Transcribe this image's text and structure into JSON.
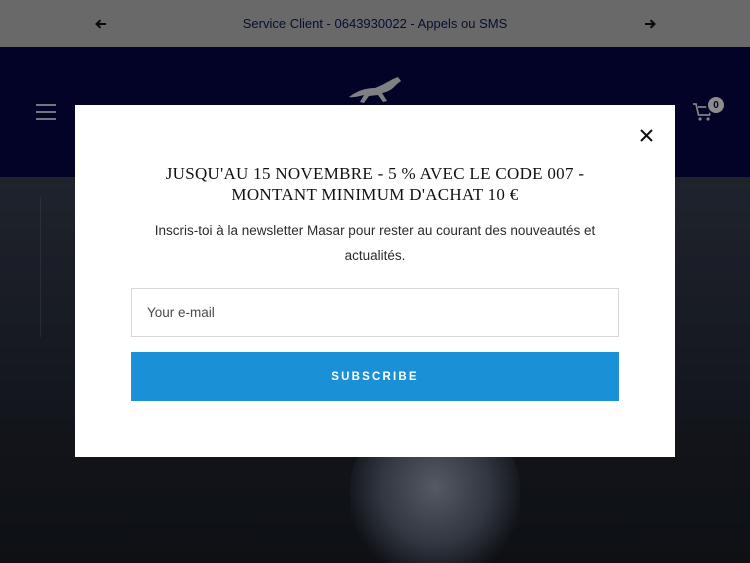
{
  "announcement": {
    "text": "Service Client - 0643930022 - Appels ou SMS",
    "prev_icon": "arrow-left-icon",
    "next_icon": "arrow-right-icon"
  },
  "header": {
    "menu_icon": "hamburger-menu-icon",
    "logo_icon": "horse-logo-icon",
    "cart_icon": "cart-icon",
    "cart_count": "0"
  },
  "popup": {
    "title_line1": "JUSQU'AU 15 NOVEMBRE - 5 % AVEC LE CODE 007 -",
    "title_line2": "MONTANT MINIMUM D'ACHAT 10 €",
    "body_line1": "Inscris-toi à la newsletter Masar pour rester au courant des nouveautés et",
    "body_line2": "actualités.",
    "email_placeholder": "Your e-mail",
    "subscribe_label": "SUBSCRIBE",
    "close_icon": "close-icon",
    "accent_color": "#1a90d6"
  }
}
